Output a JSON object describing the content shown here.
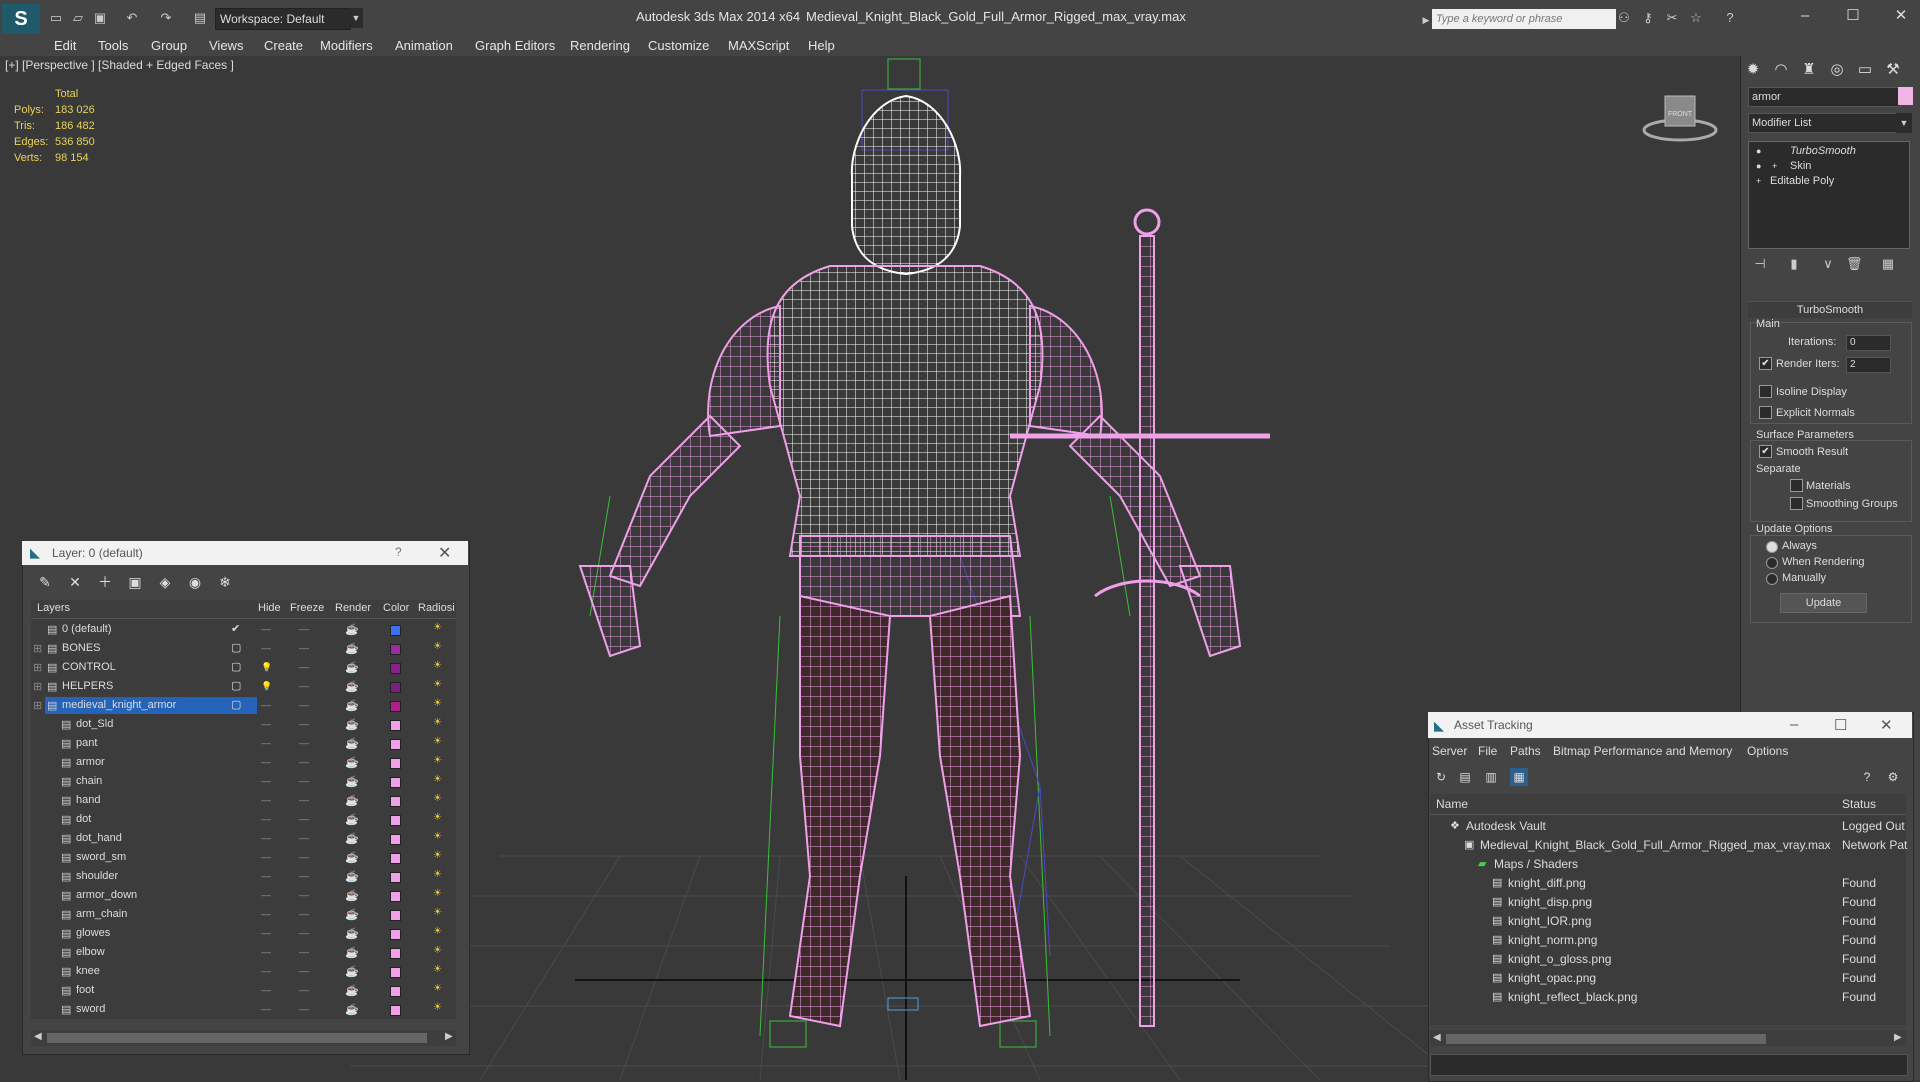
{
  "titlebar": {
    "workspace": "Workspace: Default",
    "app_title": "Autodesk 3ds Max  2014 x64",
    "file_title": "Medieval_Knight_Black_Gold_Full_Armor_Rigged_max_vray.max",
    "search_placeholder": "Type a keyword or phrase"
  },
  "menu": [
    "Edit",
    "Tools",
    "Group",
    "Views",
    "Create",
    "Modifiers",
    "Animation",
    "Graph Editors",
    "Rendering",
    "Customize",
    "MAXScript",
    "Help"
  ],
  "viewport": {
    "label": "[+] [Perspective ] [Shaded + Edged Faces ]",
    "stats": {
      "total_label": "Total",
      "polys_label": "Polys:",
      "polys": "183 026",
      "tris_label": "Tris:",
      "tris": "186 482",
      "edges_label": "Edges:",
      "edges": "536 850",
      "verts_label": "Verts:",
      "verts": "98 154"
    },
    "viewcube_label": "FRONT",
    "wire_color": "#f0a0e8",
    "helmet_color": "#ffffff"
  },
  "command_panel": {
    "object_name": "armor",
    "object_color": "#f0b4e6",
    "modifier_list": "Modifier List",
    "stack": [
      "TurboSmooth",
      "Skin",
      "Editable Poly"
    ],
    "rollout_title": "TurboSmooth",
    "main_label": "Main",
    "iterations_label": "Iterations:",
    "iterations": "0",
    "render_iters_label": "Render Iters:",
    "render_iters": "2",
    "isoline": "Isoline Display",
    "explicit_normals": "Explicit Normals",
    "surface_params": "Surface Parameters",
    "smooth_result": "Smooth Result",
    "separate": "Separate",
    "materials": "Materials",
    "smoothing_groups": "Smoothing Groups",
    "update_options": "Update Options",
    "always": "Always",
    "when_rendering": "When Rendering",
    "manually": "Manually",
    "update_btn": "Update"
  },
  "layer_dialog": {
    "title": "Layer: 0 (default)",
    "help": "?",
    "columns": [
      "Layers",
      "Hide",
      "Freeze",
      "Render",
      "Color",
      "Radiosi"
    ],
    "rows": [
      {
        "name": "0 (default)",
        "color": "#3c6ef0",
        "indent": 0
      },
      {
        "name": "BONES",
        "color": "#9a2ca0",
        "indent": 0
      },
      {
        "name": "CONTROL",
        "color": "#8a1f8e",
        "indent": 0
      },
      {
        "name": "HELPERS",
        "color": "#7a1f7e",
        "indent": 0
      },
      {
        "name": "medieval_knight_armor",
        "color": "#b0208a",
        "indent": 0
      },
      {
        "name": "dot_Sld",
        "color": "#f0a0e8",
        "indent": 1
      },
      {
        "name": "pant",
        "color": "#f0a0e8",
        "indent": 1
      },
      {
        "name": "armor",
        "color": "#f0a0e8",
        "indent": 1
      },
      {
        "name": "chain",
        "color": "#f0a0e8",
        "indent": 1
      },
      {
        "name": "hand",
        "color": "#f0a0e8",
        "indent": 1
      },
      {
        "name": "dot",
        "color": "#f0a0e8",
        "indent": 1
      },
      {
        "name": "dot_hand",
        "color": "#f0a0e8",
        "indent": 1
      },
      {
        "name": "sword_sm",
        "color": "#f0a0e8",
        "indent": 1
      },
      {
        "name": "shoulder",
        "color": "#f0a0e8",
        "indent": 1
      },
      {
        "name": "armor_down",
        "color": "#f0a0e8",
        "indent": 1
      },
      {
        "name": "arm_chain",
        "color": "#f0a0e8",
        "indent": 1
      },
      {
        "name": "glowes",
        "color": "#f0a0e8",
        "indent": 1
      },
      {
        "name": "elbow",
        "color": "#f0a0e8",
        "indent": 1
      },
      {
        "name": "knee",
        "color": "#f0a0e8",
        "indent": 1
      },
      {
        "name": "foot",
        "color": "#f0a0e8",
        "indent": 1
      },
      {
        "name": "sword",
        "color": "#f0a0e8",
        "indent": 1
      }
    ],
    "selected_row": "medieval_knight_armor"
  },
  "asset_tracking": {
    "title": "Asset Tracking",
    "menu": [
      "Server",
      "File",
      "Paths",
      "Bitmap Performance and Memory",
      "Options"
    ],
    "columns": [
      "Name",
      "Status"
    ],
    "rows": [
      {
        "name": "Autodesk Vault",
        "status": "Logged Out",
        "level": 0
      },
      {
        "name": "Medieval_Knight_Black_Gold_Full_Armor_Rigged_max_vray.max",
        "status": "Network Pat",
        "level": 1
      },
      {
        "name": "Maps / Shaders",
        "status": "",
        "level": 2
      },
      {
        "name": "knight_diff.png",
        "status": "Found",
        "level": 3
      },
      {
        "name": "knight_disp.png",
        "status": "Found",
        "level": 3
      },
      {
        "name": "knight_IOR.png",
        "status": "Found",
        "level": 3
      },
      {
        "name": "knight_norm.png",
        "status": "Found",
        "level": 3
      },
      {
        "name": "knight_o_gloss.png",
        "status": "Found",
        "level": 3
      },
      {
        "name": "knight_opac.png",
        "status": "Found",
        "level": 3
      },
      {
        "name": "knight_reflect_black.png",
        "status": "Found",
        "level": 3
      }
    ]
  }
}
